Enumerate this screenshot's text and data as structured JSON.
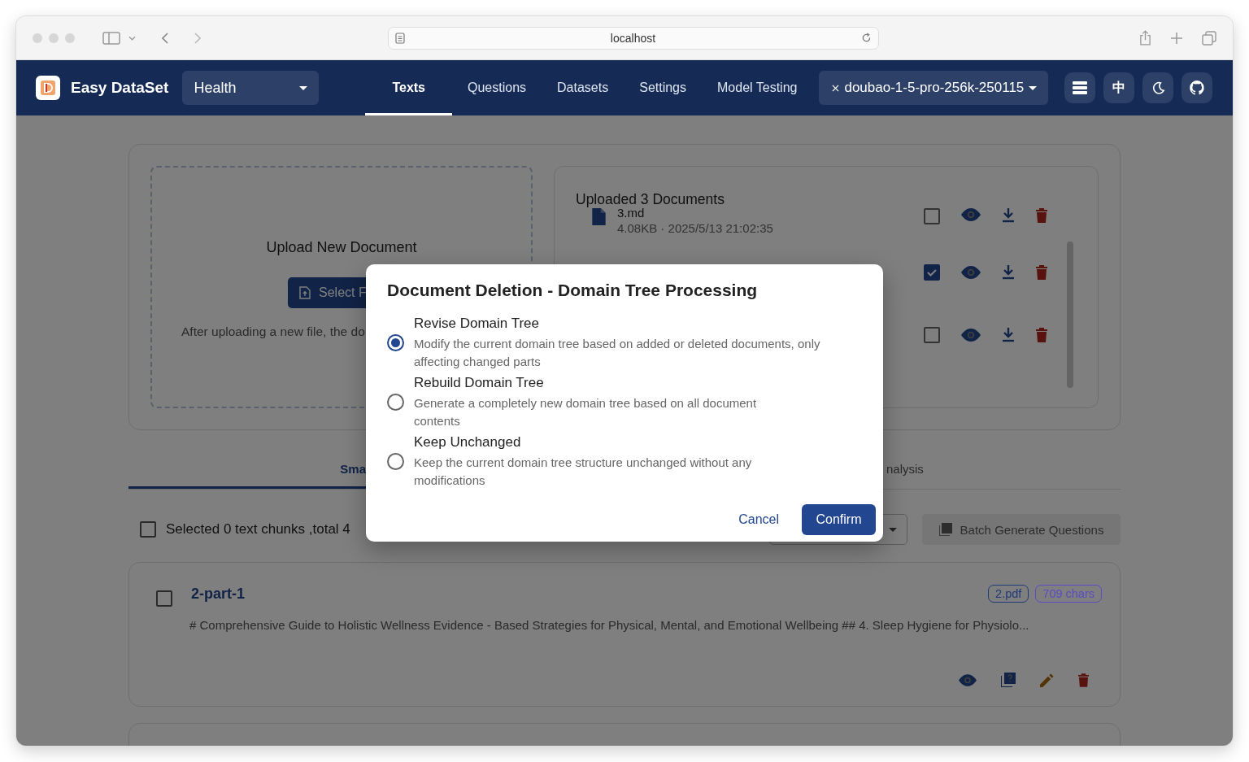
{
  "browser": {
    "url": "localhost"
  },
  "app": {
    "brand": "Easy DataSet",
    "project": "Health",
    "nav": [
      {
        "label": "Texts",
        "selected": true
      },
      {
        "label": "Questions",
        "selected": false
      },
      {
        "label": "Datasets",
        "selected": false
      },
      {
        "label": "Settings",
        "selected": false
      },
      {
        "label": "Model Testing",
        "selected": false
      }
    ],
    "model": "doubao-1-5-pro-256k-250115",
    "tools": [
      {
        "kind": "list"
      },
      {
        "kind": "lang",
        "label": "中"
      },
      {
        "kind": "theme"
      },
      {
        "kind": "github"
      }
    ]
  },
  "upload": {
    "title": "Upload New Document",
    "button": "Select F",
    "hint": "After uploading a new file, the do"
  },
  "documents": {
    "title": "Uploaded 3 Documents",
    "items": [
      {
        "name": "3.md",
        "meta": "4.08KB · 2025/5/13 21:02:35",
        "checked": false
      },
      {
        "checked": true
      },
      {
        "checked": false
      }
    ]
  },
  "tabs": [
    {
      "label": "Sma",
      "selected": true
    },
    {
      "label": "nalysis",
      "selected": false
    }
  ],
  "selection": {
    "checked": false,
    "text": "Selected 0 text chunks ,total 4"
  },
  "batch_button": {
    "label": "Batch Generate Questions",
    "disabled": true
  },
  "chunks": [
    {
      "checked": false,
      "title": "2-part-1",
      "tags": [
        {
          "label": "2.pdf",
          "color": "#1e3a78"
        },
        {
          "label": "709 chars",
          "color": "#5b4bc4"
        }
      ],
      "content": "# Comprehensive Guide to Holistic Wellness Evidence - Based Strategies for Physical, Mental, and Emotional Wellbeing ## 4. Sleep Hygiene for Physiolo..."
    }
  ],
  "dialog": {
    "title": "Document Deletion - Domain Tree Processing",
    "options": [
      {
        "title": "Revise Domain Tree",
        "description": "Modify the current domain tree based on added or deleted documents, only affecting changed parts",
        "selected": true
      },
      {
        "title": "Rebuild Domain Tree",
        "description": "Generate a completely new domain tree based on all document contents",
        "selected": false
      },
      {
        "title": "Keep Unchanged",
        "description": "Keep the current domain tree structure unchanged without any modifications",
        "selected": false
      }
    ],
    "cancel": "Cancel",
    "confirm": "Confirm"
  }
}
